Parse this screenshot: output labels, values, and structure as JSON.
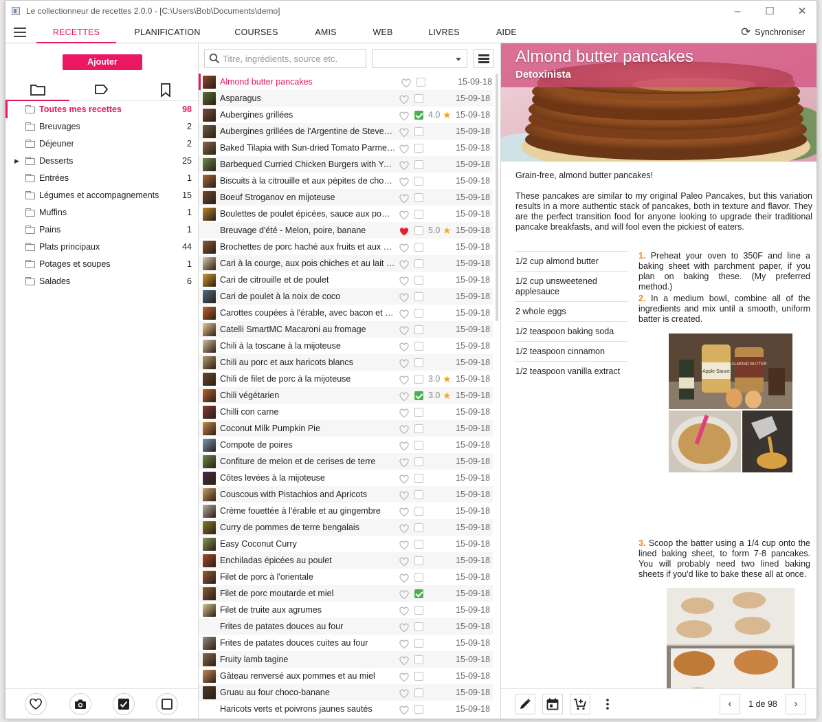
{
  "window": {
    "title": "Le collectionneur de recettes 2.0.0 -  [C:\\Users\\Bob\\Documents\\demo]",
    "min_glyph": "–",
    "max_glyph": "☐",
    "close_glyph": "✕"
  },
  "menu": {
    "tabs": [
      "RECETTES",
      "PLANIFICATION",
      "COURSES",
      "AMIS",
      "WEB",
      "LIVRES",
      "AIDE"
    ],
    "active": "RECETTES",
    "sync_label": "Synchroniser"
  },
  "left": {
    "add_label": "Ajouter",
    "tabs": [
      "folder-icon",
      "tag-icon",
      "bookmark-icon"
    ],
    "folders": [
      {
        "name": "Toutes mes recettes",
        "count": "98",
        "active": true
      },
      {
        "name": "Breuvages",
        "count": "2"
      },
      {
        "name": "Déjeuner",
        "count": "2"
      },
      {
        "name": "Desserts",
        "count": "25",
        "expandable": true
      },
      {
        "name": "Entrées",
        "count": "1"
      },
      {
        "name": "Légumes et accompagnements",
        "count": "15"
      },
      {
        "name": "Muffins",
        "count": "1"
      },
      {
        "name": "Pains",
        "count": "1"
      },
      {
        "name": "Plats principaux",
        "count": "44"
      },
      {
        "name": "Potages et soupes",
        "count": "1"
      },
      {
        "name": "Salades",
        "count": "6"
      }
    ],
    "bottom_icons": [
      "heart-icon",
      "camera-icon",
      "checkbox-checked-icon",
      "checkbox-empty-icon"
    ]
  },
  "list": {
    "search_placeholder": "Titre, ingrédients, source etc.",
    "filter_value": "",
    "recipes": [
      {
        "title": "Almond butter pancakes",
        "date": "15-09-18",
        "selected": true,
        "thumb": "#8a4a2c"
      },
      {
        "title": "Asparagus",
        "date": "15-09-18",
        "thumb": "#5b6e3a"
      },
      {
        "title": "Aubergines grillées",
        "date": "15-09-18",
        "checked": true,
        "rating": "4.0",
        "thumb": "#7a4e3a"
      },
      {
        "title": "Aubergines grillées de l'Argentine de Steven Raichlen",
        "date": "15-09-18",
        "thumb": "#6e5a3e"
      },
      {
        "title": "Baked Tilapia with Sun-dried Tomato Parmesan",
        "date": "15-09-18",
        "thumb": "#8c6b4a"
      },
      {
        "title": "Barbequed Curried Chicken Burgers with Yogurt",
        "date": "15-09-18",
        "thumb": "#6d8a4a"
      },
      {
        "title": "Biscuits à la citrouille et aux pépites de chocolat",
        "date": "15-09-18",
        "thumb": "#a86a3a"
      },
      {
        "title": "Boeuf Stroganov en mijoteuse",
        "date": "15-09-18",
        "thumb": "#6a4a30"
      },
      {
        "title": "Boulettes de poulet épicées, sauce aux pommes",
        "date": "15-09-18",
        "thumb": "#b8862e"
      },
      {
        "title": "Breuvage d'été - Melon, poire, banane",
        "date": "15-09-18",
        "liked": true,
        "rating": "5.0",
        "thumb": ""
      },
      {
        "title": "Brochettes de porc haché aux fruits et aux noix",
        "date": "15-09-18",
        "thumb": "#8a5a36"
      },
      {
        "title": "Cari à la courge, aux pois chiches et au lait de coco",
        "date": "15-09-18",
        "thumb": "#d8c8a8"
      },
      {
        "title": "Cari de citrouille et de poulet",
        "date": "15-09-18",
        "thumb": "#d29a30"
      },
      {
        "title": "Cari de poulet à la noix de coco",
        "date": "15-09-18",
        "thumb": "#4a6e8a"
      },
      {
        "title": "Carottes coupées à l'érable, avec bacon et pacanes",
        "date": "15-09-18",
        "thumb": "#c8642e"
      },
      {
        "title": "Catelli SmartMC Macaroni au fromage",
        "date": "15-09-18",
        "thumb": "#e8c890"
      },
      {
        "title": "Chili à la toscane à la mijoteuse",
        "date": "15-09-18",
        "thumb": "#d8c0a0"
      },
      {
        "title": "Chili au porc et aux haricots blancs",
        "date": "15-09-18",
        "thumb": "#b89a70"
      },
      {
        "title": "Chili de filet de porc à la mijoteuse",
        "date": "15-09-18",
        "rating": "3.0",
        "thumb": "#6a4a2a"
      },
      {
        "title": "Chili végétarien",
        "date": "15-09-18",
        "checked": true,
        "rating": "3.0",
        "thumb": "#b8622e"
      },
      {
        "title": "Chilli con carne",
        "date": "15-09-18",
        "thumb": "#8a3a3a"
      },
      {
        "title": "Coconut Milk Pumpkin Pie",
        "date": "15-09-18",
        "thumb": "#c88a48"
      },
      {
        "title": "Compote de poires",
        "date": "15-09-18",
        "thumb": "#7a9ab8"
      },
      {
        "title": "Confiture de melon et de cerises de terre",
        "date": "15-09-18",
        "thumb": "#6a8a4a"
      },
      {
        "title": "Côtes levées à la mijoteuse",
        "date": "15-09-18",
        "thumb": "#4a2a4a"
      },
      {
        "title": "Couscous with Pistachios and Apricots",
        "date": "15-09-18",
        "thumb": "#c8a060"
      },
      {
        "title": "Crème fouettée à l'érable et au gingembre",
        "date": "15-09-18",
        "thumb": "#b8b0a0"
      },
      {
        "title": "Curry de pommes de terre bengalais",
        "date": "15-09-18",
        "thumb": "#8a7a2a"
      },
      {
        "title": "Easy Coconut Curry",
        "date": "15-09-18",
        "thumb": "#8a9a5a"
      },
      {
        "title": "Enchiladas épicées au poulet",
        "date": "15-09-18",
        "thumb": "#a84a2a"
      },
      {
        "title": "Filet de porc à l'orientale",
        "date": "15-09-18",
        "thumb": "#9a5a3a"
      },
      {
        "title": "Filet de porc moutarde et miel",
        "date": "15-09-18",
        "checked": true,
        "thumb": "#8a5a3a"
      },
      {
        "title": "Filet de truite aux agrumes",
        "date": "15-09-18",
        "thumb": "#d8c890"
      },
      {
        "title": "Frites de patates douces au four",
        "date": "15-09-18",
        "thumb": ""
      },
      {
        "title": "Frites de patates douces cuites au four",
        "date": "15-09-18",
        "thumb": "#9a8a7a"
      },
      {
        "title": "Fruity lamb tagine",
        "date": "15-09-18",
        "thumb": "#8a6a4a"
      },
      {
        "title": "Gâteau renversé aux pommes et au miel",
        "date": "15-09-18",
        "thumb": "#c88a5a"
      },
      {
        "title": "Gruau au four choco-banane",
        "date": "15-09-18",
        "thumb": "#4a3a2a"
      },
      {
        "title": "Haricots verts et poivrons jaunes sautés",
        "date": "15-09-18",
        "thumb": ""
      }
    ]
  },
  "detail": {
    "title": "Almond butter pancakes",
    "source": "Detoxinista",
    "description": "Grain-free, almond butter pancakes!",
    "body": "These pancakes are similar to my original Paleo Pancakes, but this variation results in a more authentic stack of pancakes, both in texture and flavor. They are the perfect transition food for anyone looking to upgrade their traditional pancake breakfasts, and will fool even the pickiest of eaters.",
    "ingredients": [
      "1/2 cup almond butter",
      "1/2 cup unsweetened applesauce",
      "2 whole eggs",
      "1/2 teaspoon baking soda",
      "1/2 teaspoon cinnamon",
      "1/2 teaspoon vanilla extract"
    ],
    "steps": [
      {
        "num": "1.",
        "text": "Preheat your oven to 350F and line a baking sheet with parchment paper, if you plan on baking these. (My preferred method.)"
      },
      {
        "num": "2.",
        "text": "In a medium bowl, combine all of the ingredients and mix until a smooth, uniform batter is created."
      },
      {
        "num": "3.",
        "text": "Scoop the batter using a 1/4 cup onto the lined baking sheet, to form 7-8 pancakes. You will probably need two lined baking sheets if you'd like to bake these all at once."
      }
    ],
    "photo_labels": [
      "Apple Sauce",
      "ALMOND BUTTER"
    ],
    "pager": {
      "text": "1 de 98",
      "prev": "‹",
      "next": "›"
    },
    "tools": [
      "edit-icon",
      "calendar-icon",
      "add-to-cart-icon",
      "more-vert-icon"
    ]
  },
  "colors": {
    "accent": "#e6195d",
    "star": "#f5a623",
    "check": "#4caf50",
    "step_number": "#e58a2b"
  }
}
